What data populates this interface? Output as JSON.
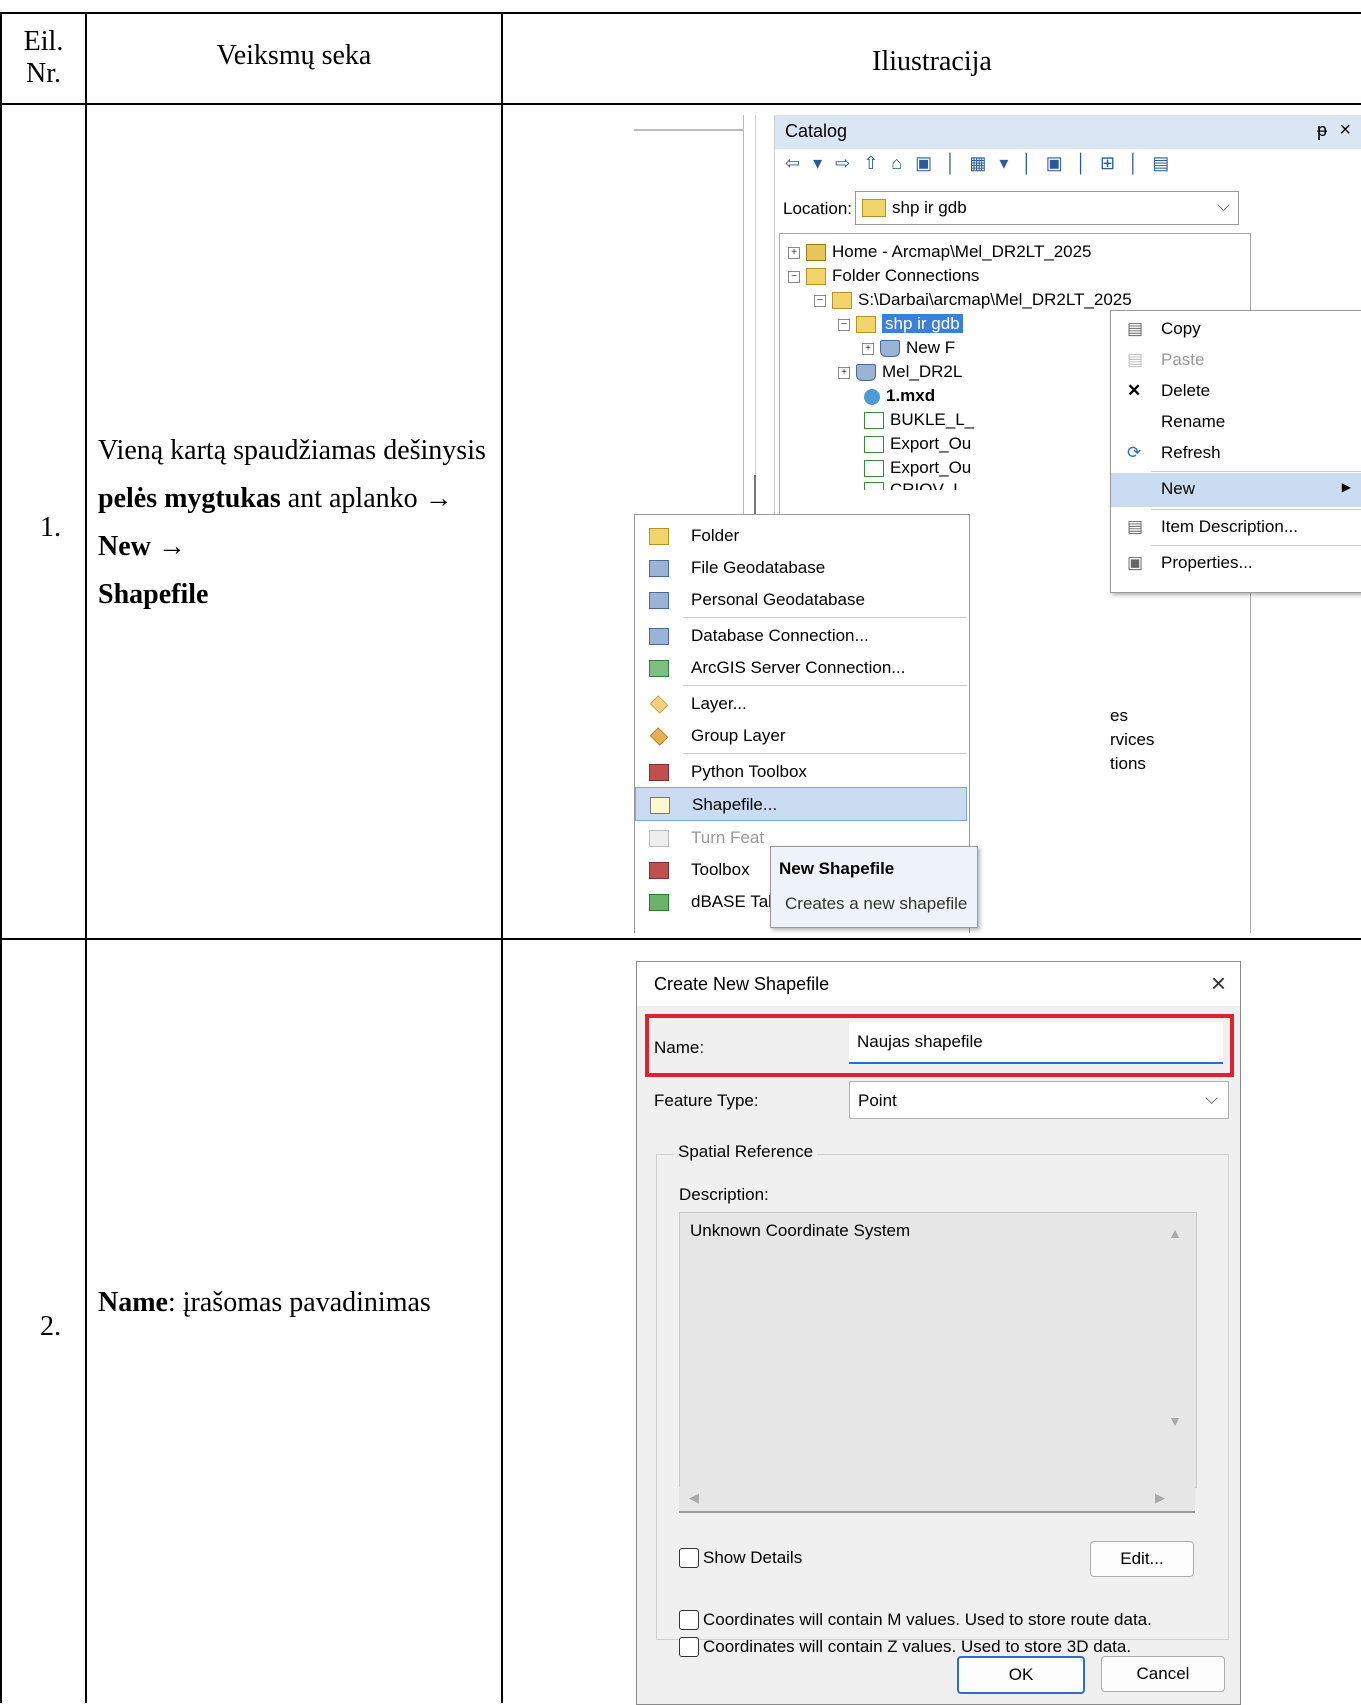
{
  "table": {
    "header": {
      "col1": "Eil.\nNr.",
      "col2": "Veiksmų seka",
      "col3": "Iliustracija"
    },
    "rows": [
      {
        "num": "1.",
        "text_parts": [
          "Vieną kartą spaudžiamas dešinysis ",
          "pelės mygtukas",
          " ant aplanko → ",
          "New",
          " →",
          "Shapefile"
        ]
      },
      {
        "num": "2.",
        "text_parts": [
          "Name",
          ": įrašomas pavadinimas"
        ]
      }
    ]
  },
  "catalog": {
    "title": "Catalog",
    "pin": "ᵽ",
    "close": "×",
    "toolbar_glyphs": "⇦ ▾ ⇨ ⇧ ⌂ ▣ │ ▦ ▾ │ ▣ │ ⊞ │ ▤",
    "location_label": "Location:",
    "location_value": "shp ir gdb",
    "tree": [
      "Home - Arcmap\\Mel_DR2LT_2025",
      "Folder Connections",
      "S:\\Darbai\\arcmap\\Mel_DR2LT_2025",
      "shp ir gdb",
      "New F",
      "Mel_DR2L",
      "1.mxd",
      "BUKLE_L_",
      "Export_Ou",
      "Export_Ou",
      "CRIOV_L"
    ],
    "behind_partial": [
      "es",
      "rvices",
      "tions"
    ],
    "context_menu": [
      "Copy",
      "Paste",
      "Delete",
      "Rename",
      "Refresh",
      "New",
      "Item Description...",
      "Properties..."
    ],
    "new_submenu": [
      "Folder",
      "File Geodatabase",
      "Personal Geodatabase",
      "Database Connection...",
      "ArcGIS Server Connection...",
      "Layer...",
      "Group Layer",
      "Python Toolbox",
      "Shapefile...",
      "Turn Feat",
      "Toolbox",
      "dBASE Tal"
    ],
    "tooltip": {
      "title": "New Shapefile",
      "text": "Creates a new shapefile"
    }
  },
  "dialog": {
    "title": "Create New Shapefile",
    "close": "×",
    "name_label": "Name:",
    "name_value": "Naujas shapefile",
    "feature_type_label": "Feature Type:",
    "feature_type_value": "Point",
    "spatial_reference_label": "Spatial Reference",
    "description_label": "Description:",
    "description_value": "Unknown Coordinate System",
    "show_details": "Show Details",
    "edit_button": "Edit...",
    "m_values": "Coordinates will contain M values. Used to store route data.",
    "z_values": "Coordinates will contain Z values. Used to store 3D data.",
    "ok_button": "OK",
    "cancel_button": "Cancel",
    "highlight_color": "#e0222e"
  }
}
